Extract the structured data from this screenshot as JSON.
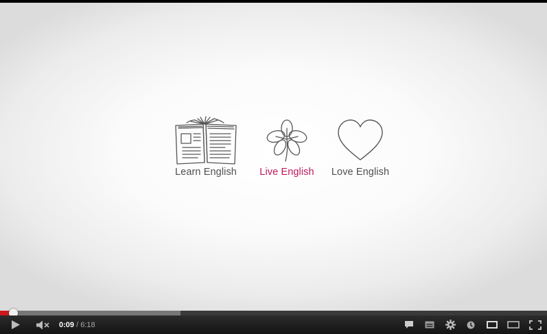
{
  "video": {
    "captions": {
      "learn": "Learn English",
      "live": "Live English",
      "love": "Love English"
    },
    "colors": {
      "accent_pink": "#c2185b",
      "caption_gray": "#4f4f4f",
      "progress_red": "#cc181e"
    }
  },
  "player": {
    "progress": {
      "played_fraction": 0.024,
      "loaded_fraction": 0.33
    },
    "time": {
      "current": "0:09",
      "separator": " / ",
      "duration": "6:18"
    },
    "icons": {
      "play": "play-icon",
      "volume": "volume-muted-icon",
      "annotations": "annotations-icon",
      "captions": "captions-icon",
      "settings": "gear-icon",
      "watch_later": "watch-later-icon",
      "small_player": "small-player-icon",
      "large_player": "large-player-icon",
      "fullscreen": "fullscreen-icon"
    }
  }
}
